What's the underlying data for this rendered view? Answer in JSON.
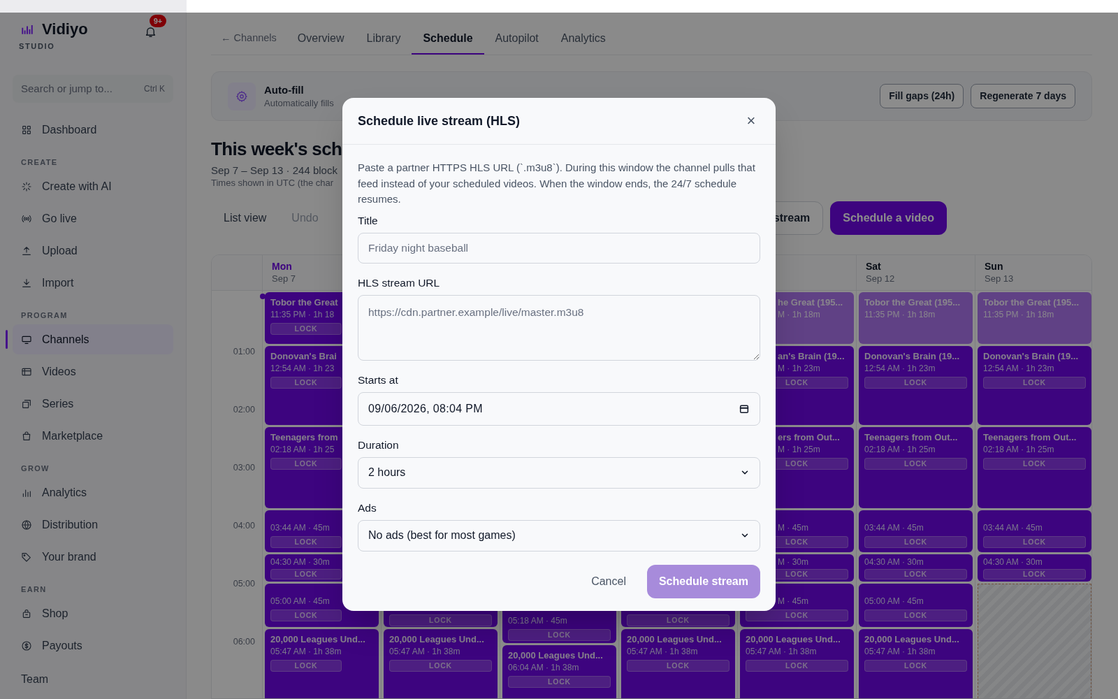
{
  "app": {
    "name": "Vidiyo",
    "subtitle": "STUDIO",
    "notifications": "9+"
  },
  "search": {
    "placeholder": "Search or jump to...",
    "shortcut": "Ctrl K"
  },
  "sidebar": {
    "entries": [
      {
        "kind": "item",
        "label": "Dashboard",
        "selected": false
      },
      {
        "kind": "heading",
        "label": "CREATE"
      },
      {
        "kind": "item",
        "label": "Create with AI",
        "selected": false
      },
      {
        "kind": "item",
        "label": "Go live",
        "selected": false
      },
      {
        "kind": "item",
        "label": "Upload",
        "selected": false
      },
      {
        "kind": "item",
        "label": "Import",
        "selected": false
      },
      {
        "kind": "heading",
        "label": "PROGRAM"
      },
      {
        "kind": "item",
        "label": "Channels",
        "selected": true
      },
      {
        "kind": "item",
        "label": "Videos",
        "selected": false
      },
      {
        "kind": "item",
        "label": "Series",
        "selected": false
      },
      {
        "kind": "item",
        "label": "Marketplace",
        "selected": false
      },
      {
        "kind": "heading",
        "label": "GROW"
      },
      {
        "kind": "item",
        "label": "Analytics",
        "selected": false
      },
      {
        "kind": "item",
        "label": "Distribution",
        "selected": false
      },
      {
        "kind": "item",
        "label": "Your brand",
        "selected": false
      },
      {
        "kind": "heading",
        "label": "EARN"
      },
      {
        "kind": "item",
        "label": "Shop",
        "selected": false
      },
      {
        "kind": "item",
        "label": "Payouts",
        "selected": false
      },
      {
        "kind": "footer",
        "label": "Team"
      }
    ]
  },
  "back_link": "← Channels",
  "tabs": [
    {
      "label": "Overview",
      "selected": false
    },
    {
      "label": "Library",
      "selected": false
    },
    {
      "label": "Schedule",
      "selected": true
    },
    {
      "label": "Autopilot",
      "selected": false
    },
    {
      "label": "Analytics",
      "selected": false
    }
  ],
  "autofill": {
    "title": "Auto-fill",
    "subtitle": "Automatically fills",
    "actions": [
      "Fill gaps (24h)",
      "Regenerate 7 days"
    ]
  },
  "week": {
    "heading": "This week's sch",
    "summary": "Sep 7 – Sep 13 · 244 block",
    "note": "Times shown in UTC (the char"
  },
  "toolbar": {
    "buttons": [
      {
        "label": "List view",
        "disabled": false
      },
      {
        "label": "Undo",
        "disabled": true
      }
    ],
    "stream_button": "stream",
    "primary_button": "Schedule a video"
  },
  "calendar": {
    "hours": [
      "01:00",
      "02:00",
      "03:00",
      "04:00",
      "05:00",
      "06:00"
    ],
    "days": [
      {
        "name": "Mon",
        "date": "Sep 7",
        "today": true,
        "kind": "full",
        "blocks": [
          {
            "kind": "titled",
            "title": "Tobor the Great",
            "time": "11:35 PM · 1h 18",
            "lock": "LOCK",
            "dimmed": false
          },
          {
            "kind": "titled",
            "title": "Donovan's Brai",
            "time": "12:54 AM · 1h 23",
            "lock": "LOCK",
            "dimmed": false
          },
          {
            "kind": "titled",
            "title": "Teenagers from",
            "time": "02:18 AM · 1h 25",
            "lock": "LOCK",
            "dimmed": false
          },
          {
            "kind": "untitled",
            "time": "03:44 AM · 45m",
            "lock": "LOCK",
            "dimmed": false
          },
          {
            "kind": "compact",
            "time": "04:30 AM · 30m",
            "lock": "LOCK",
            "dimmed": false
          },
          {
            "kind": "untitled",
            "time": "05:00 AM · 45m",
            "lock": "LOCK",
            "dimmed": false
          },
          {
            "kind": "titled",
            "title": "20,000 Leagues Und...",
            "time": "05:47 AM · 1h 38m",
            "lock": "LOCK",
            "dimmed": false
          }
        ]
      },
      {
        "kind": "covered",
        "blocks": [
          {
            "kind": "lock_only",
            "lock": "LOCK",
            "dimmed": false
          },
          {
            "kind": "titled",
            "title": "20,000 Leagues Und...",
            "time": "05:47 AM · 1h 38m",
            "lock": "LOCK",
            "dimmed": false
          }
        ]
      },
      {
        "kind": "covered",
        "blocks": [
          {
            "kind": "untitled",
            "time": "05:18 AM · 45m",
            "lock": "LOCK",
            "dimmed": false
          },
          {
            "kind": "titled",
            "title": "20,000 Leagues Und...",
            "time": "06:04 AM · 1h 38m",
            "lock": "LOCK",
            "dimmed": false
          }
        ]
      },
      {
        "kind": "covered",
        "blocks": [
          {
            "kind": "lock_only",
            "lock": "LOCK",
            "dimmed": false
          },
          {
            "kind": "titled",
            "title": "20,000 Leagues Und...",
            "time": "05:47 AM · 1h 38m",
            "lock": "LOCK",
            "dimmed": false
          }
        ]
      },
      {
        "kind": "beside_modal",
        "blocks": [
          {
            "kind": "titled",
            "title": "he Great (195...",
            "time": "M · 1h 18m",
            "dimmed": true
          },
          {
            "kind": "titled",
            "title": "an's Brain (19...",
            "time": "M · 1h 23m",
            "lock": "LOCK",
            "dimmed": false
          },
          {
            "kind": "titled",
            "title": "ers from Out...",
            "time": "M · 1h 25m",
            "lock": "LOCK",
            "dimmed": false
          },
          {
            "kind": "untitled",
            "time": "M · 45m",
            "lock": "LOCK",
            "dimmed": false
          },
          {
            "kind": "compact",
            "time": "M · 30m",
            "lock": "LOCK",
            "dimmed": false
          },
          {
            "kind": "untitled",
            "time": "M · 45m",
            "lock": "LOCK",
            "dimmed": false
          },
          {
            "kind": "titled",
            "title": "20,000 Leagues Und...",
            "time": "05:47 AM · 1h 38m",
            "lock": "LOCK",
            "dimmed": false
          }
        ]
      },
      {
        "name": "Sat",
        "date": "Sep 12",
        "today": false,
        "kind": "full",
        "blocks": [
          {
            "kind": "titled",
            "title": "Tobor the Great (195...",
            "time": "11:35 PM · 1h 18m",
            "dimmed": true
          },
          {
            "kind": "titled",
            "title": "Donovan's Brain (19...",
            "time": "12:54 AM · 1h 23m",
            "lock": "LOCK",
            "dimmed": false
          },
          {
            "kind": "titled",
            "title": "Teenagers from Out...",
            "time": "02:18 AM · 1h 25m",
            "lock": "LOCK",
            "dimmed": false
          },
          {
            "kind": "untitled",
            "time": "03:44 AM · 45m",
            "lock": "LOCK",
            "dimmed": false
          },
          {
            "kind": "compact",
            "time": "04:30 AM · 30m",
            "lock": "LOCK",
            "dimmed": false
          },
          {
            "kind": "untitled",
            "time": "05:00 AM · 45m",
            "lock": "LOCK",
            "dimmed": false
          },
          {
            "kind": "titled",
            "title": "20,000 Leagues Und...",
            "time": "05:47 AM · 1h 38m",
            "lock": "LOCK",
            "dimmed": false
          }
        ]
      },
      {
        "name": "Sun",
        "date": "Sep 13",
        "today": false,
        "kind": "open_end",
        "blocks": [
          {
            "kind": "titled",
            "title": "Tobor the Great (195...",
            "time": "11:35 PM · 1h 18m",
            "dimmed": true
          },
          {
            "kind": "titled",
            "title": "Donovan's Brain (19...",
            "time": "12:54 AM · 1h 23m",
            "lock": "LOCK",
            "dimmed": false
          },
          {
            "kind": "titled",
            "title": "Teenagers from Out...",
            "time": "02:18 AM · 1h 25m",
            "lock": "LOCK",
            "dimmed": false
          },
          {
            "kind": "untitled",
            "time": "03:44 AM · 45m",
            "lock": "LOCK",
            "dimmed": false
          },
          {
            "kind": "compact",
            "time": "04:30 AM · 30m",
            "lock": "LOCK",
            "dimmed": false
          }
        ]
      }
    ]
  },
  "modal": {
    "title": "Schedule live stream (HLS)",
    "close": "×",
    "description": "Paste a partner HTTPS HLS URL (`.m3u8`). During this window the channel pulls that feed instead of your scheduled videos. When the window ends, the 24/7 schedule resumes.",
    "fields": [
      {
        "kind": "text",
        "label": "Title",
        "placeholder": "Friday night baseball"
      },
      {
        "kind": "textarea",
        "label": "HLS stream URL",
        "placeholder": "https://cdn.partner.example/live/master.m3u8"
      },
      {
        "kind": "datetime",
        "label": "Starts at",
        "value": "09/06/2026, 08:04 PM"
      },
      {
        "kind": "select",
        "label": "Duration",
        "value": "2 hours"
      },
      {
        "kind": "select",
        "label": "Ads",
        "value": "No ads (best for most games)"
      }
    ],
    "cancel": "Cancel",
    "submit": {
      "label": "Schedule stream",
      "disabled": true
    }
  }
}
